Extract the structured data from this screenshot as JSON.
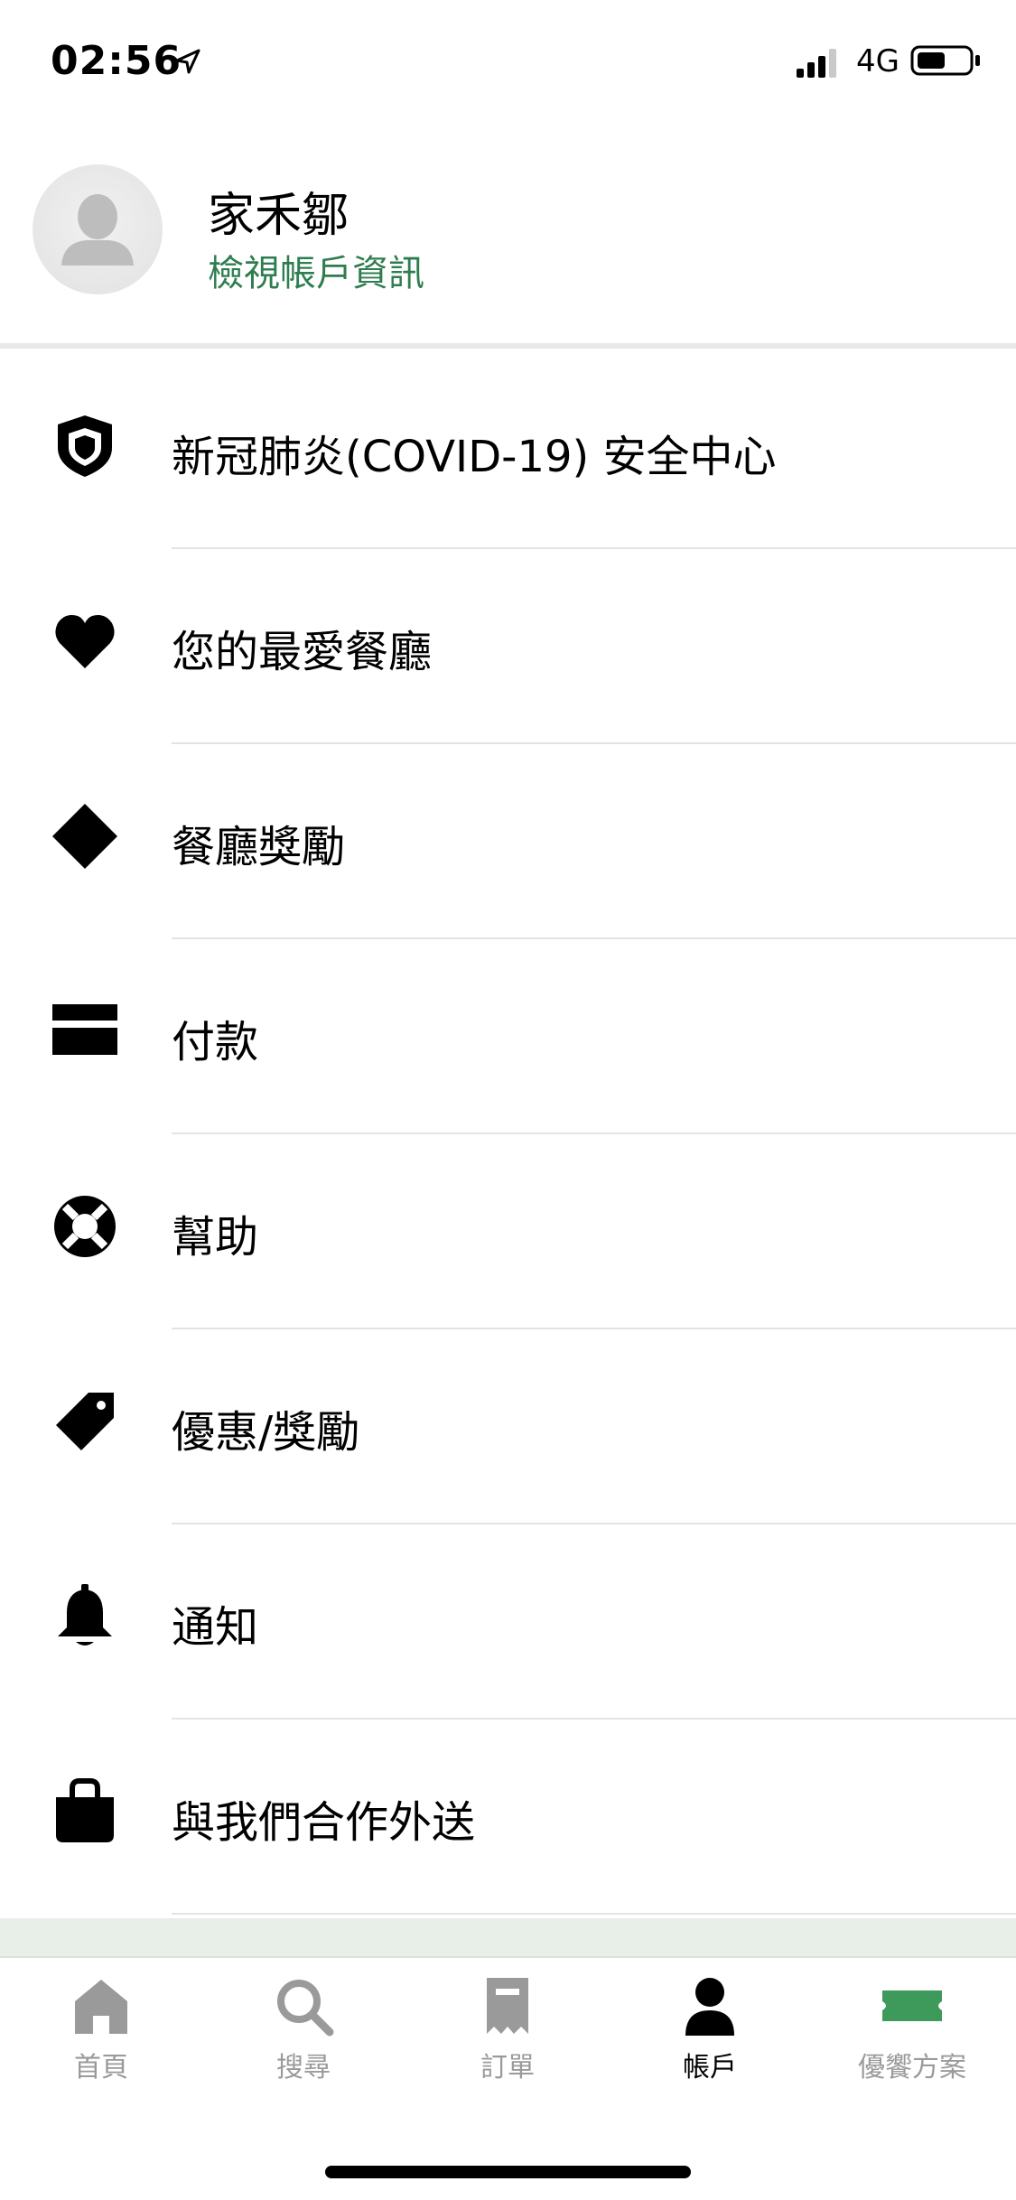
{
  "status_bar": {
    "time": "02:56",
    "network": "4G",
    "icons": [
      "location-arrow-icon",
      "signal-icon",
      "battery-icon"
    ]
  },
  "profile": {
    "given_name": "家禾",
    "family_name": "鄒",
    "view_account_label": "檢視帳戶資訊",
    "avatar_icon": "person-placeholder-icon"
  },
  "menu": {
    "items": [
      {
        "label_a": "新冠肺炎",
        "label_b": "(COVID-19) 安全中心",
        "icon": "shield-icon"
      },
      {
        "label": "您的最愛餐廳",
        "icon": "heart-icon"
      },
      {
        "label": "餐廳獎勵",
        "icon": "diamond-icon"
      },
      {
        "label": "付款",
        "icon": "credit-card-icon"
      },
      {
        "label": "幫助",
        "icon": "lifebuoy-icon"
      },
      {
        "label": "優惠/獎勵",
        "icon": "tag-icon"
      },
      {
        "label": "通知",
        "icon": "bell-icon"
      },
      {
        "label": "與我們合作外送",
        "icon": "bag-icon"
      }
    ]
  },
  "tab_bar": {
    "tabs": [
      {
        "label": "首頁",
        "icon": "home-icon"
      },
      {
        "label": "搜尋",
        "icon": "search-icon"
      },
      {
        "label": "訂單",
        "icon": "receipt-icon"
      },
      {
        "label": "帳戶",
        "icon": "person-icon",
        "active": true
      },
      {
        "label": "優饗方案",
        "icon": "ticket-icon"
      }
    ]
  },
  "colors": {
    "accent_green": "#3d9a5b",
    "link_green": "#2e7d4f",
    "inactive_gray": "#9a9a9a",
    "band": "#e8efe9"
  }
}
